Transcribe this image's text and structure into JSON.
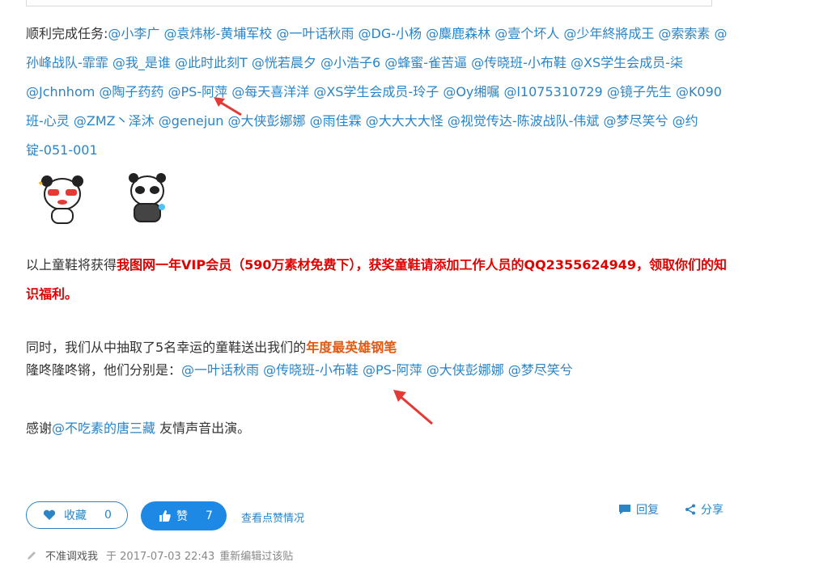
{
  "intro_label": "顺利完成任务:",
  "mentions": [
    "@小李广",
    "@袁炜彬-黄埔军校",
    "@一叶话秋雨",
    "@DG-小杨",
    "@麋鹿森林",
    "@壹个坏人",
    "@少年終將成王",
    "@索索素",
    "@孙峰战队-霏霏",
    "@我_是谁",
    "@此时此刻T",
    "@恍若晨夕",
    "@小浩子6",
    "@蜂蜜-雀苦逼",
    "@传晓班-小布鞋",
    "@XS学生会成员-柒",
    "@Jchnhom",
    "@陶子药药",
    "@PS-阿萍",
    "@每天喜洋洋",
    "@XS学生会成员-玲子",
    "@Oy缃嘱",
    "@l1075310729",
    "@镜子先生",
    "@K090班-心灵",
    "@ZMZ丶泽沐",
    "@genejun",
    "@大侠彭娜娜",
    "@雨佳霖",
    "@大大大大怪",
    "@视觉传达-陈波战队-伟斌",
    "@梦尽笑兮",
    "@约锭-051-001"
  ],
  "prize": {
    "prefix": "以上童鞋将获得",
    "red_text": "我图网一年VIP会员（590万素材免费下），获奖童鞋请添加工作人员的QQ2355624949，领取你们的知识福利。"
  },
  "lottery": {
    "line1_prefix": "同时，我们从中抽取了5名幸运的童鞋送出我们的",
    "line1_highlight": "年度最英雄钢笔",
    "line2_prefix": "隆咚隆咚锵，他们分别是：",
    "winners": [
      "@一叶话秋雨",
      "@传晓班-小布鞋",
      "@PS-阿萍",
      "@大侠彭娜娜",
      "@梦尽笑兮"
    ]
  },
  "thanks": {
    "prefix": "感谢",
    "mention": "@不吃素的唐三藏",
    "suffix": " 友情声音出演。"
  },
  "actions": {
    "fav_label": "收藏",
    "fav_count": "0",
    "like_label": "赞",
    "like_count": "7",
    "view_likes": "查看点赞情况",
    "reply": "回复",
    "share": "分享"
  },
  "footer": {
    "user": "不准调戏我",
    "date": "于 2017-07-03 22:43",
    "note": "重新编辑过该贴"
  },
  "colors": {
    "link": "#2a84c6",
    "prize_red": "#e00000",
    "highlight_orange": "#e25a13",
    "like_bg": "#1e88e5",
    "arrow_red": "#e53935"
  },
  "icons": [
    "panda-emoji-icon",
    "heart-icon",
    "thumbs-up-icon",
    "comment-icon",
    "share-icon",
    "pencil-icon",
    "red-arrow-icon"
  ]
}
